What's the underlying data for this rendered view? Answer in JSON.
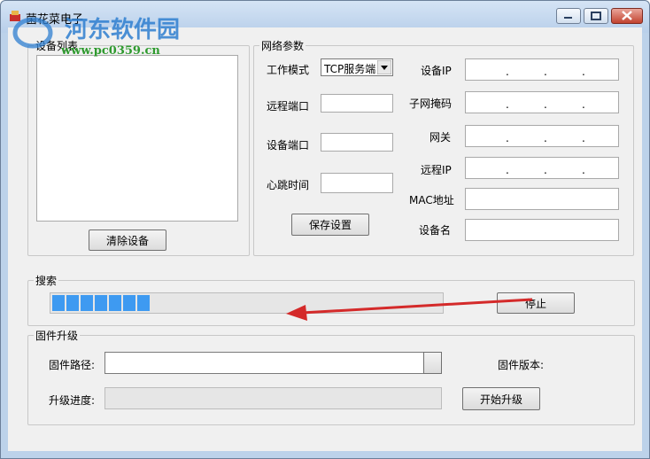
{
  "window": {
    "title": "菌花菜电子"
  },
  "device_list": {
    "group_label": "设备列表",
    "clear_button": "清除设备"
  },
  "network": {
    "group_label": "网络参数",
    "work_mode_label": "工作模式",
    "work_mode_value": "TCP服务端",
    "remote_port_label": "远程端口",
    "device_port_label": "设备端口",
    "heartbeat_label": "心跳时间",
    "save_button": "保存设置",
    "device_ip_label": "设备IP",
    "subnet_label": "子网掩码",
    "gateway_label": "网关",
    "remote_ip_label": "远程IP",
    "mac_label": "MAC地址",
    "device_name_label": "设备名",
    "ip_separator": "."
  },
  "search": {
    "group_label": "搜索",
    "stop_button": "停止",
    "progress_segments": 7
  },
  "firmware": {
    "group_label": "固件升级",
    "path_label": "固件路径:",
    "version_label": "固件版本:",
    "progress_label": "升级进度:",
    "start_button": "开始升级"
  },
  "watermark": {
    "text": "河东软件园",
    "url": "www.pc0359.cn"
  },
  "colors": {
    "progress": "#3e9af1",
    "arrow": "#d42a2a",
    "watermark_blue": "#2f7fd0",
    "watermark_green": "#2f9a2f"
  }
}
